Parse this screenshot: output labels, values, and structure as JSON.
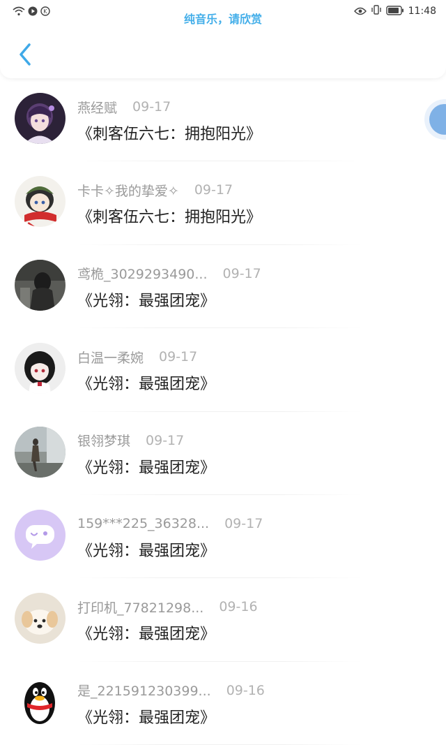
{
  "status_bar": {
    "title": "纯音乐，请欣赏",
    "time": "11:48"
  },
  "header": {
    "back_icon": "chevron-left-icon"
  },
  "colors": {
    "accent": "#43aee9",
    "name_text": "#9a9a9a",
    "title_text": "#222222"
  },
  "items": [
    {
      "name": "燕经赋",
      "date": "09-17",
      "title": "《刺客伍六七：拥抱阳光》",
      "avatar": "anime-girl-purple-avatar"
    },
    {
      "name": "卡卡✧我的挚爱✧",
      "date": "09-17",
      "title": "《刺客伍六七：拥抱阳光》",
      "avatar": "anime-boy-red-scarf-avatar"
    },
    {
      "name": "鸢桅_3029293490...",
      "date": "09-17",
      "title": "《光翎：最强团宠》",
      "avatar": "dark-figure-avatar"
    },
    {
      "name": "白温一柔婉",
      "date": "09-17",
      "title": "《光翎：最强团宠》",
      "avatar": "anime-girl-black-hair-avatar"
    },
    {
      "name": "银翎梦琪",
      "date": "09-17",
      "title": "《光翎：最强团宠》",
      "avatar": "waterfall-figure-avatar"
    },
    {
      "name": "159***225_36328...",
      "date": "09-17",
      "title": "《光翎：最强团宠》",
      "avatar": "chat-bubble-default-avatar"
    },
    {
      "name": "打印机_77821298...",
      "date": "09-16",
      "title": "《光翎：最强团宠》",
      "avatar": "puppy-avatar"
    },
    {
      "name": "是_221591230399...",
      "date": "09-16",
      "title": "《光翎：最强团宠》",
      "avatar": "qq-penguin-avatar"
    }
  ]
}
